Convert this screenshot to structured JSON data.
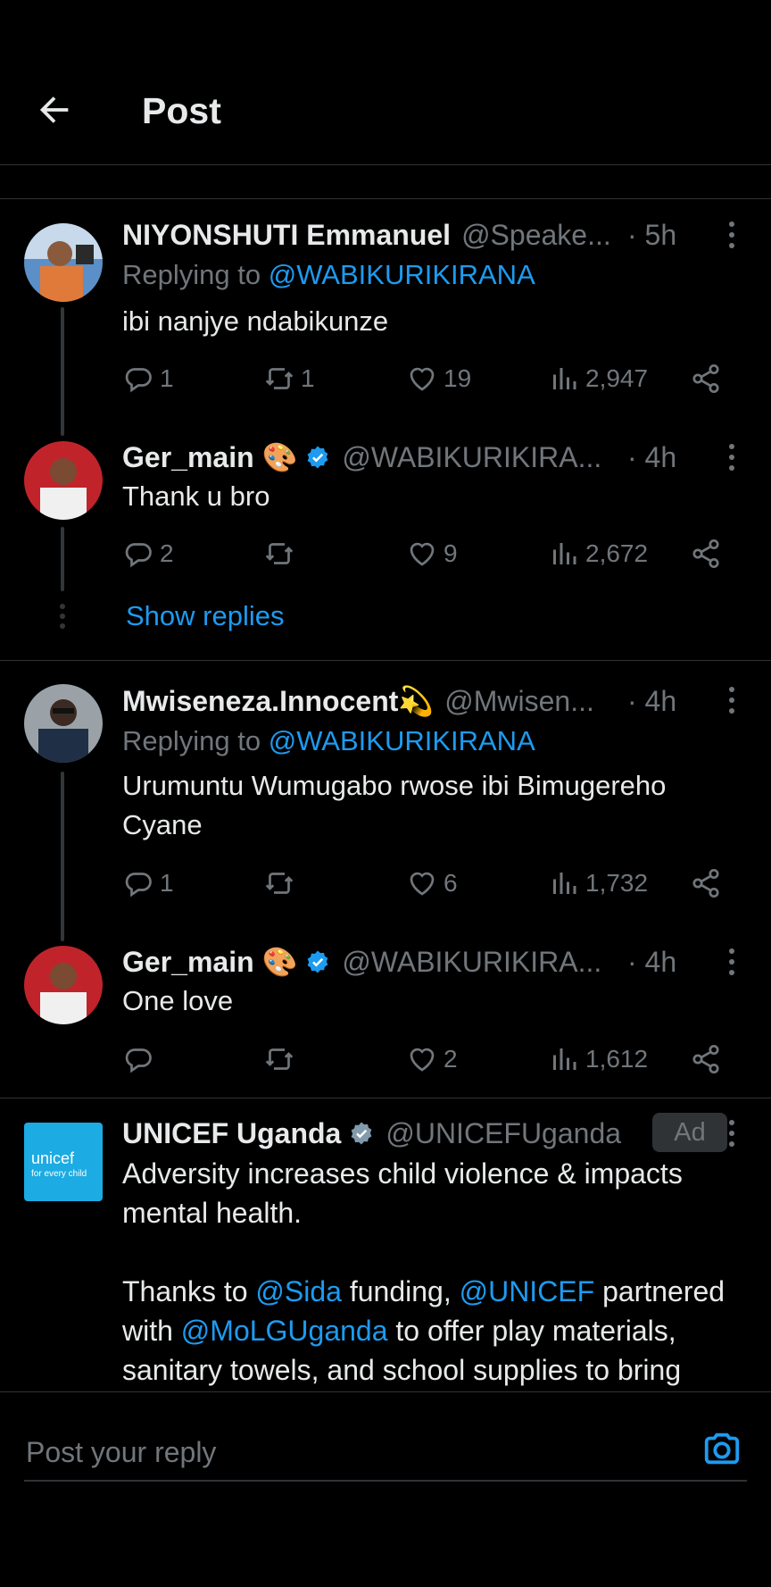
{
  "header": {
    "title": "Post"
  },
  "posts": [
    {
      "name": "NIYONSHUTI Emmanuel",
      "handle": "@Speake...",
      "time": "· 5h",
      "replying_prefix": "Replying to ",
      "replying_to": "@WABIKURIKIRANA",
      "text": "ibi nanjye ndabikunze",
      "replies": "1",
      "reposts": "1",
      "likes": "19",
      "views": "2,947"
    },
    {
      "name": "Ger_main 🎨",
      "handle": "@WABIKURIKIRA...",
      "time": "· 4h",
      "text": "Thank u bro",
      "replies": "2",
      "reposts": "",
      "likes": "9",
      "views": "2,672"
    },
    {
      "name": "Mwiseneza.Innocent💫",
      "handle": "@Mwisen...",
      "time": "· 4h",
      "replying_prefix": "Replying to ",
      "replying_to": "@WABIKURIKIRANA",
      "text_line1": "Urumuntu Wumugabo rwose ibi Bimugereho",
      "text_line2": "Cyane",
      "replies": "1",
      "reposts": "",
      "likes": "6",
      "views": "1,732"
    },
    {
      "name": "Ger_main 🎨",
      "handle": "@WABIKURIKIRA...",
      "time": "· 4h",
      "text": "One love",
      "replies": "",
      "reposts": "",
      "likes": "2",
      "views": "1,612"
    }
  ],
  "show_replies": "Show replies",
  "ad": {
    "name": "UNICEF Uganda",
    "handle": "@UNICEFUganda",
    "tag": "Ad",
    "logo_text": "unicef",
    "logo_sub": "for every child",
    "line1": "Adversity increases child violence & impacts",
    "line2": "mental health.",
    "p2_a": "Thanks to ",
    "p2_link1": "@Sida",
    "p2_b": " funding, ",
    "p2_link2": "@UNICEF",
    "p2_c": " partnered",
    "p3_a": "with ",
    "p3_link": "@MoLGUganda",
    "p3_b": " to offer play materials,",
    "p4": "sanitary towels, and school supplies to bring"
  },
  "reply_box": {
    "placeholder": "Post your reply"
  },
  "colors": {
    "accent": "#1d9bf0",
    "muted": "#71767b",
    "divider": "#2f3336",
    "background": "#000000"
  }
}
